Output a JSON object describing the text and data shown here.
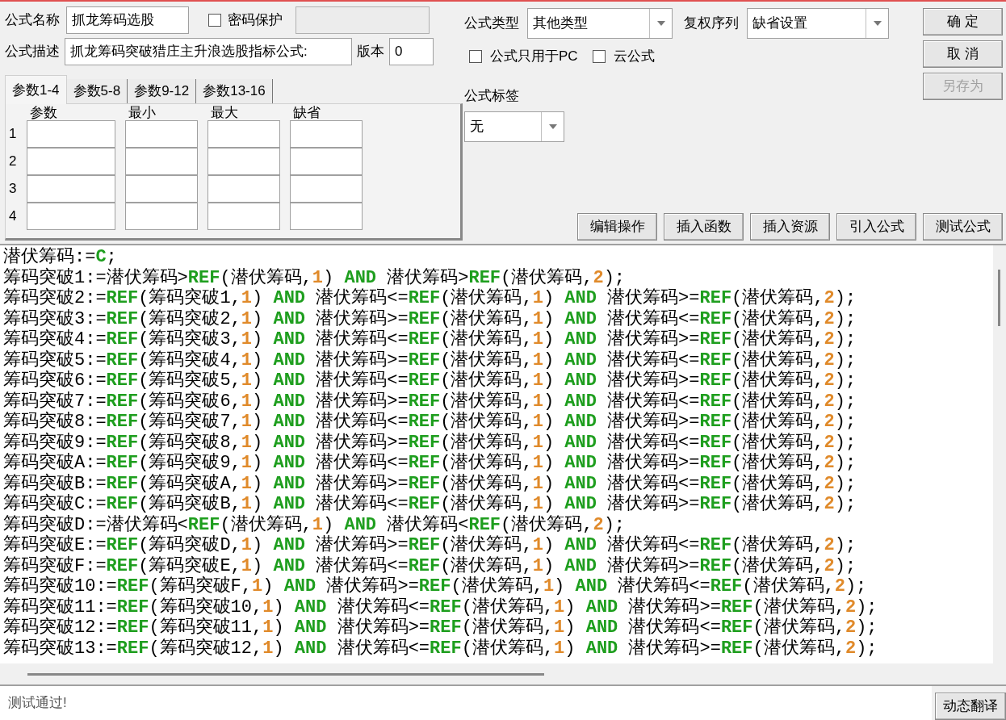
{
  "formula_name": {
    "label": "公式名称",
    "value": "抓龙筹码选股"
  },
  "password": {
    "label": "密码保护",
    "checked": false,
    "field_disabled": true
  },
  "description": {
    "label": "公式描述",
    "value": "抓龙筹码突破猎庄主升浪选股指标公式:"
  },
  "version": {
    "label": "版本",
    "value": "0"
  },
  "tabs": [
    {
      "label": "参数1-4",
      "selected": true
    },
    {
      "label": "参数5-8",
      "selected": false
    },
    {
      "label": "参数9-12",
      "selected": false
    },
    {
      "label": "参数13-16",
      "selected": false
    }
  ],
  "params": {
    "columns": [
      "参数",
      "最小",
      "最大",
      "缺省"
    ],
    "rows": [
      {
        "index": "1"
      },
      {
        "index": "2"
      },
      {
        "index": "3"
      },
      {
        "index": "4"
      }
    ]
  },
  "formula_type": {
    "label": "公式类型",
    "value": "其他类型"
  },
  "adjust_sequence": {
    "label": "复权序列",
    "value": "缺省设置"
  },
  "options": [
    {
      "label": "公式只用于PC",
      "checked": false
    },
    {
      "label": "云公式",
      "checked": false
    }
  ],
  "formula_tag": {
    "label": "公式标签",
    "value": "无"
  },
  "side_buttons": [
    {
      "label": "确 定",
      "disabled": false
    },
    {
      "label": "取 消",
      "disabled": false
    },
    {
      "label": "另存为",
      "disabled": true
    }
  ],
  "tool_buttons": [
    "编辑操作",
    "插入函数",
    "插入资源",
    "引入公式",
    "测试公式"
  ],
  "code_lines": [
    [
      {
        "kind": "plain",
        "text": "潜伏筹码:="
      },
      {
        "kind": "func",
        "text": "C"
      },
      {
        "kind": "plain",
        "text": ";"
      }
    ],
    [
      {
        "kind": "plain",
        "text": "筹码突破1:=潜伏筹码>"
      },
      {
        "kind": "func",
        "text": "REF"
      },
      {
        "kind": "plain",
        "text": "(潜伏筹码,"
      },
      {
        "kind": "num",
        "text": "1"
      },
      {
        "kind": "plain",
        "text": ") "
      },
      {
        "kind": "keyword",
        "text": "AND"
      },
      {
        "kind": "plain",
        "text": " 潜伏筹码>"
      },
      {
        "kind": "func",
        "text": "REF"
      },
      {
        "kind": "plain",
        "text": "(潜伏筹码,"
      },
      {
        "kind": "num",
        "text": "2"
      },
      {
        "kind": "plain",
        "text": ");"
      }
    ],
    [
      {
        "kind": "plain",
        "text": "筹码突破2:="
      },
      {
        "kind": "func",
        "text": "REF"
      },
      {
        "kind": "plain",
        "text": "(筹码突破1,"
      },
      {
        "kind": "num",
        "text": "1"
      },
      {
        "kind": "plain",
        "text": ") "
      },
      {
        "kind": "keyword",
        "text": "AND"
      },
      {
        "kind": "plain",
        "text": " 潜伏筹码<="
      },
      {
        "kind": "func",
        "text": "REF"
      },
      {
        "kind": "plain",
        "text": "(潜伏筹码,"
      },
      {
        "kind": "num",
        "text": "1"
      },
      {
        "kind": "plain",
        "text": ") "
      },
      {
        "kind": "keyword",
        "text": "AND"
      },
      {
        "kind": "plain",
        "text": " 潜伏筹码>="
      },
      {
        "kind": "func",
        "text": "REF"
      },
      {
        "kind": "plain",
        "text": "(潜伏筹码,"
      },
      {
        "kind": "num",
        "text": "2"
      },
      {
        "kind": "plain",
        "text": ");"
      }
    ],
    [
      {
        "kind": "plain",
        "text": "筹码突破3:="
      },
      {
        "kind": "func",
        "text": "REF"
      },
      {
        "kind": "plain",
        "text": "(筹码突破2,"
      },
      {
        "kind": "num",
        "text": "1"
      },
      {
        "kind": "plain",
        "text": ") "
      },
      {
        "kind": "keyword",
        "text": "AND"
      },
      {
        "kind": "plain",
        "text": " 潜伏筹码>="
      },
      {
        "kind": "func",
        "text": "REF"
      },
      {
        "kind": "plain",
        "text": "(潜伏筹码,"
      },
      {
        "kind": "num",
        "text": "1"
      },
      {
        "kind": "plain",
        "text": ") "
      },
      {
        "kind": "keyword",
        "text": "AND"
      },
      {
        "kind": "plain",
        "text": " 潜伏筹码<="
      },
      {
        "kind": "func",
        "text": "REF"
      },
      {
        "kind": "plain",
        "text": "(潜伏筹码,"
      },
      {
        "kind": "num",
        "text": "2"
      },
      {
        "kind": "plain",
        "text": ");"
      }
    ],
    [
      {
        "kind": "plain",
        "text": "筹码突破4:="
      },
      {
        "kind": "func",
        "text": "REF"
      },
      {
        "kind": "plain",
        "text": "(筹码突破3,"
      },
      {
        "kind": "num",
        "text": "1"
      },
      {
        "kind": "plain",
        "text": ") "
      },
      {
        "kind": "keyword",
        "text": "AND"
      },
      {
        "kind": "plain",
        "text": " 潜伏筹码<="
      },
      {
        "kind": "func",
        "text": "REF"
      },
      {
        "kind": "plain",
        "text": "(潜伏筹码,"
      },
      {
        "kind": "num",
        "text": "1"
      },
      {
        "kind": "plain",
        "text": ") "
      },
      {
        "kind": "keyword",
        "text": "AND"
      },
      {
        "kind": "plain",
        "text": " 潜伏筹码>="
      },
      {
        "kind": "func",
        "text": "REF"
      },
      {
        "kind": "plain",
        "text": "(潜伏筹码,"
      },
      {
        "kind": "num",
        "text": "2"
      },
      {
        "kind": "plain",
        "text": ");"
      }
    ],
    [
      {
        "kind": "plain",
        "text": "筹码突破5:="
      },
      {
        "kind": "func",
        "text": "REF"
      },
      {
        "kind": "plain",
        "text": "(筹码突破4,"
      },
      {
        "kind": "num",
        "text": "1"
      },
      {
        "kind": "plain",
        "text": ") "
      },
      {
        "kind": "keyword",
        "text": "AND"
      },
      {
        "kind": "plain",
        "text": " 潜伏筹码>="
      },
      {
        "kind": "func",
        "text": "REF"
      },
      {
        "kind": "plain",
        "text": "(潜伏筹码,"
      },
      {
        "kind": "num",
        "text": "1"
      },
      {
        "kind": "plain",
        "text": ") "
      },
      {
        "kind": "keyword",
        "text": "AND"
      },
      {
        "kind": "plain",
        "text": " 潜伏筹码<="
      },
      {
        "kind": "func",
        "text": "REF"
      },
      {
        "kind": "plain",
        "text": "(潜伏筹码,"
      },
      {
        "kind": "num",
        "text": "2"
      },
      {
        "kind": "plain",
        "text": ");"
      }
    ],
    [
      {
        "kind": "plain",
        "text": "筹码突破6:="
      },
      {
        "kind": "func",
        "text": "REF"
      },
      {
        "kind": "plain",
        "text": "(筹码突破5,"
      },
      {
        "kind": "num",
        "text": "1"
      },
      {
        "kind": "plain",
        "text": ") "
      },
      {
        "kind": "keyword",
        "text": "AND"
      },
      {
        "kind": "plain",
        "text": " 潜伏筹码<="
      },
      {
        "kind": "func",
        "text": "REF"
      },
      {
        "kind": "plain",
        "text": "(潜伏筹码,"
      },
      {
        "kind": "num",
        "text": "1"
      },
      {
        "kind": "plain",
        "text": ") "
      },
      {
        "kind": "keyword",
        "text": "AND"
      },
      {
        "kind": "plain",
        "text": " 潜伏筹码>="
      },
      {
        "kind": "func",
        "text": "REF"
      },
      {
        "kind": "plain",
        "text": "(潜伏筹码,"
      },
      {
        "kind": "num",
        "text": "2"
      },
      {
        "kind": "plain",
        "text": ");"
      }
    ],
    [
      {
        "kind": "plain",
        "text": "筹码突破7:="
      },
      {
        "kind": "func",
        "text": "REF"
      },
      {
        "kind": "plain",
        "text": "(筹码突破6,"
      },
      {
        "kind": "num",
        "text": "1"
      },
      {
        "kind": "plain",
        "text": ") "
      },
      {
        "kind": "keyword",
        "text": "AND"
      },
      {
        "kind": "plain",
        "text": " 潜伏筹码>="
      },
      {
        "kind": "func",
        "text": "REF"
      },
      {
        "kind": "plain",
        "text": "(潜伏筹码,"
      },
      {
        "kind": "num",
        "text": "1"
      },
      {
        "kind": "plain",
        "text": ") "
      },
      {
        "kind": "keyword",
        "text": "AND"
      },
      {
        "kind": "plain",
        "text": " 潜伏筹码<="
      },
      {
        "kind": "func",
        "text": "REF"
      },
      {
        "kind": "plain",
        "text": "(潜伏筹码,"
      },
      {
        "kind": "num",
        "text": "2"
      },
      {
        "kind": "plain",
        "text": ");"
      }
    ],
    [
      {
        "kind": "plain",
        "text": "筹码突破8:="
      },
      {
        "kind": "func",
        "text": "REF"
      },
      {
        "kind": "plain",
        "text": "(筹码突破7,"
      },
      {
        "kind": "num",
        "text": "1"
      },
      {
        "kind": "plain",
        "text": ") "
      },
      {
        "kind": "keyword",
        "text": "AND"
      },
      {
        "kind": "plain",
        "text": " 潜伏筹码<="
      },
      {
        "kind": "func",
        "text": "REF"
      },
      {
        "kind": "plain",
        "text": "(潜伏筹码,"
      },
      {
        "kind": "num",
        "text": "1"
      },
      {
        "kind": "plain",
        "text": ") "
      },
      {
        "kind": "keyword",
        "text": "AND"
      },
      {
        "kind": "plain",
        "text": " 潜伏筹码>="
      },
      {
        "kind": "func",
        "text": "REF"
      },
      {
        "kind": "plain",
        "text": "(潜伏筹码,"
      },
      {
        "kind": "num",
        "text": "2"
      },
      {
        "kind": "plain",
        "text": ");"
      }
    ],
    [
      {
        "kind": "plain",
        "text": "筹码突破9:="
      },
      {
        "kind": "func",
        "text": "REF"
      },
      {
        "kind": "plain",
        "text": "(筹码突破8,"
      },
      {
        "kind": "num",
        "text": "1"
      },
      {
        "kind": "plain",
        "text": ") "
      },
      {
        "kind": "keyword",
        "text": "AND"
      },
      {
        "kind": "plain",
        "text": " 潜伏筹码>="
      },
      {
        "kind": "func",
        "text": "REF"
      },
      {
        "kind": "plain",
        "text": "(潜伏筹码,"
      },
      {
        "kind": "num",
        "text": "1"
      },
      {
        "kind": "plain",
        "text": ") "
      },
      {
        "kind": "keyword",
        "text": "AND"
      },
      {
        "kind": "plain",
        "text": " 潜伏筹码<="
      },
      {
        "kind": "func",
        "text": "REF"
      },
      {
        "kind": "plain",
        "text": "(潜伏筹码,"
      },
      {
        "kind": "num",
        "text": "2"
      },
      {
        "kind": "plain",
        "text": ");"
      }
    ],
    [
      {
        "kind": "plain",
        "text": "筹码突破A:="
      },
      {
        "kind": "func",
        "text": "REF"
      },
      {
        "kind": "plain",
        "text": "(筹码突破9,"
      },
      {
        "kind": "num",
        "text": "1"
      },
      {
        "kind": "plain",
        "text": ") "
      },
      {
        "kind": "keyword",
        "text": "AND"
      },
      {
        "kind": "plain",
        "text": " 潜伏筹码<="
      },
      {
        "kind": "func",
        "text": "REF"
      },
      {
        "kind": "plain",
        "text": "(潜伏筹码,"
      },
      {
        "kind": "num",
        "text": "1"
      },
      {
        "kind": "plain",
        "text": ") "
      },
      {
        "kind": "keyword",
        "text": "AND"
      },
      {
        "kind": "plain",
        "text": " 潜伏筹码>="
      },
      {
        "kind": "func",
        "text": "REF"
      },
      {
        "kind": "plain",
        "text": "(潜伏筹码,"
      },
      {
        "kind": "num",
        "text": "2"
      },
      {
        "kind": "plain",
        "text": ");"
      }
    ],
    [
      {
        "kind": "plain",
        "text": "筹码突破B:="
      },
      {
        "kind": "func",
        "text": "REF"
      },
      {
        "kind": "plain",
        "text": "(筹码突破A,"
      },
      {
        "kind": "num",
        "text": "1"
      },
      {
        "kind": "plain",
        "text": ") "
      },
      {
        "kind": "keyword",
        "text": "AND"
      },
      {
        "kind": "plain",
        "text": " 潜伏筹码>="
      },
      {
        "kind": "func",
        "text": "REF"
      },
      {
        "kind": "plain",
        "text": "(潜伏筹码,"
      },
      {
        "kind": "num",
        "text": "1"
      },
      {
        "kind": "plain",
        "text": ") "
      },
      {
        "kind": "keyword",
        "text": "AND"
      },
      {
        "kind": "plain",
        "text": " 潜伏筹码<="
      },
      {
        "kind": "func",
        "text": "REF"
      },
      {
        "kind": "plain",
        "text": "(潜伏筹码,"
      },
      {
        "kind": "num",
        "text": "2"
      },
      {
        "kind": "plain",
        "text": ");"
      }
    ],
    [
      {
        "kind": "plain",
        "text": "筹码突破C:="
      },
      {
        "kind": "func",
        "text": "REF"
      },
      {
        "kind": "plain",
        "text": "(筹码突破B,"
      },
      {
        "kind": "num",
        "text": "1"
      },
      {
        "kind": "plain",
        "text": ") "
      },
      {
        "kind": "keyword",
        "text": "AND"
      },
      {
        "kind": "plain",
        "text": " 潜伏筹码<="
      },
      {
        "kind": "func",
        "text": "REF"
      },
      {
        "kind": "plain",
        "text": "(潜伏筹码,"
      },
      {
        "kind": "num",
        "text": "1"
      },
      {
        "kind": "plain",
        "text": ") "
      },
      {
        "kind": "keyword",
        "text": "AND"
      },
      {
        "kind": "plain",
        "text": " 潜伏筹码>="
      },
      {
        "kind": "func",
        "text": "REF"
      },
      {
        "kind": "plain",
        "text": "(潜伏筹码,"
      },
      {
        "kind": "num",
        "text": "2"
      },
      {
        "kind": "plain",
        "text": ");"
      }
    ],
    [
      {
        "kind": "plain",
        "text": "筹码突破D:=潜伏筹码<"
      },
      {
        "kind": "func",
        "text": "REF"
      },
      {
        "kind": "plain",
        "text": "(潜伏筹码,"
      },
      {
        "kind": "num",
        "text": "1"
      },
      {
        "kind": "plain",
        "text": ") "
      },
      {
        "kind": "keyword",
        "text": "AND"
      },
      {
        "kind": "plain",
        "text": " 潜伏筹码<"
      },
      {
        "kind": "func",
        "text": "REF"
      },
      {
        "kind": "plain",
        "text": "(潜伏筹码,"
      },
      {
        "kind": "num",
        "text": "2"
      },
      {
        "kind": "plain",
        "text": ");"
      }
    ],
    [
      {
        "kind": "plain",
        "text": "筹码突破E:="
      },
      {
        "kind": "func",
        "text": "REF"
      },
      {
        "kind": "plain",
        "text": "(筹码突破D,"
      },
      {
        "kind": "num",
        "text": "1"
      },
      {
        "kind": "plain",
        "text": ") "
      },
      {
        "kind": "keyword",
        "text": "AND"
      },
      {
        "kind": "plain",
        "text": " 潜伏筹码>="
      },
      {
        "kind": "func",
        "text": "REF"
      },
      {
        "kind": "plain",
        "text": "(潜伏筹码,"
      },
      {
        "kind": "num",
        "text": "1"
      },
      {
        "kind": "plain",
        "text": ") "
      },
      {
        "kind": "keyword",
        "text": "AND"
      },
      {
        "kind": "plain",
        "text": " 潜伏筹码<="
      },
      {
        "kind": "func",
        "text": "REF"
      },
      {
        "kind": "plain",
        "text": "(潜伏筹码,"
      },
      {
        "kind": "num",
        "text": "2"
      },
      {
        "kind": "plain",
        "text": ");"
      }
    ],
    [
      {
        "kind": "plain",
        "text": "筹码突破F:="
      },
      {
        "kind": "func",
        "text": "REF"
      },
      {
        "kind": "plain",
        "text": "(筹码突破E,"
      },
      {
        "kind": "num",
        "text": "1"
      },
      {
        "kind": "plain",
        "text": ") "
      },
      {
        "kind": "keyword",
        "text": "AND"
      },
      {
        "kind": "plain",
        "text": " 潜伏筹码<="
      },
      {
        "kind": "func",
        "text": "REF"
      },
      {
        "kind": "plain",
        "text": "(潜伏筹码,"
      },
      {
        "kind": "num",
        "text": "1"
      },
      {
        "kind": "plain",
        "text": ") "
      },
      {
        "kind": "keyword",
        "text": "AND"
      },
      {
        "kind": "plain",
        "text": " 潜伏筹码>="
      },
      {
        "kind": "func",
        "text": "REF"
      },
      {
        "kind": "plain",
        "text": "(潜伏筹码,"
      },
      {
        "kind": "num",
        "text": "2"
      },
      {
        "kind": "plain",
        "text": ");"
      }
    ],
    [
      {
        "kind": "plain",
        "text": "筹码突破10:="
      },
      {
        "kind": "func",
        "text": "REF"
      },
      {
        "kind": "plain",
        "text": "(筹码突破F,"
      },
      {
        "kind": "num",
        "text": "1"
      },
      {
        "kind": "plain",
        "text": ") "
      },
      {
        "kind": "keyword",
        "text": "AND"
      },
      {
        "kind": "plain",
        "text": " 潜伏筹码>="
      },
      {
        "kind": "func",
        "text": "REF"
      },
      {
        "kind": "plain",
        "text": "(潜伏筹码,"
      },
      {
        "kind": "num",
        "text": "1"
      },
      {
        "kind": "plain",
        "text": ") "
      },
      {
        "kind": "keyword",
        "text": "AND"
      },
      {
        "kind": "plain",
        "text": " 潜伏筹码<="
      },
      {
        "kind": "func",
        "text": "REF"
      },
      {
        "kind": "plain",
        "text": "(潜伏筹码,"
      },
      {
        "kind": "num",
        "text": "2"
      },
      {
        "kind": "plain",
        "text": ");"
      }
    ],
    [
      {
        "kind": "plain",
        "text": "筹码突破11:="
      },
      {
        "kind": "func",
        "text": "REF"
      },
      {
        "kind": "plain",
        "text": "(筹码突破10,"
      },
      {
        "kind": "num",
        "text": "1"
      },
      {
        "kind": "plain",
        "text": ") "
      },
      {
        "kind": "keyword",
        "text": "AND"
      },
      {
        "kind": "plain",
        "text": " 潜伏筹码<="
      },
      {
        "kind": "func",
        "text": "REF"
      },
      {
        "kind": "plain",
        "text": "(潜伏筹码,"
      },
      {
        "kind": "num",
        "text": "1"
      },
      {
        "kind": "plain",
        "text": ") "
      },
      {
        "kind": "keyword",
        "text": "AND"
      },
      {
        "kind": "plain",
        "text": " 潜伏筹码>="
      },
      {
        "kind": "func",
        "text": "REF"
      },
      {
        "kind": "plain",
        "text": "(潜伏筹码,"
      },
      {
        "kind": "num",
        "text": "2"
      },
      {
        "kind": "plain",
        "text": ");"
      }
    ],
    [
      {
        "kind": "plain",
        "text": "筹码突破12:="
      },
      {
        "kind": "func",
        "text": "REF"
      },
      {
        "kind": "plain",
        "text": "(筹码突破11,"
      },
      {
        "kind": "num",
        "text": "1"
      },
      {
        "kind": "plain",
        "text": ") "
      },
      {
        "kind": "keyword",
        "text": "AND"
      },
      {
        "kind": "plain",
        "text": " 潜伏筹码>="
      },
      {
        "kind": "func",
        "text": "REF"
      },
      {
        "kind": "plain",
        "text": "(潜伏筹码,"
      },
      {
        "kind": "num",
        "text": "1"
      },
      {
        "kind": "plain",
        "text": ") "
      },
      {
        "kind": "keyword",
        "text": "AND"
      },
      {
        "kind": "plain",
        "text": " 潜伏筹码<="
      },
      {
        "kind": "func",
        "text": "REF"
      },
      {
        "kind": "plain",
        "text": "(潜伏筹码,"
      },
      {
        "kind": "num",
        "text": "2"
      },
      {
        "kind": "plain",
        "text": ");"
      }
    ],
    [
      {
        "kind": "plain",
        "text": "筹码突破13:="
      },
      {
        "kind": "func",
        "text": "REF"
      },
      {
        "kind": "plain",
        "text": "(筹码突破12,"
      },
      {
        "kind": "num",
        "text": "1"
      },
      {
        "kind": "plain",
        "text": ") "
      },
      {
        "kind": "keyword",
        "text": "AND"
      },
      {
        "kind": "plain",
        "text": " 潜伏筹码<="
      },
      {
        "kind": "func",
        "text": "REF"
      },
      {
        "kind": "plain",
        "text": "(潜伏筹码,"
      },
      {
        "kind": "num",
        "text": "1"
      },
      {
        "kind": "plain",
        "text": ") "
      },
      {
        "kind": "keyword",
        "text": "AND"
      },
      {
        "kind": "plain",
        "text": " 潜伏筹码>="
      },
      {
        "kind": "func",
        "text": "REF"
      },
      {
        "kind": "plain",
        "text": "(潜伏筹码,"
      },
      {
        "kind": "num",
        "text": "2"
      },
      {
        "kind": "plain",
        "text": ");"
      }
    ]
  ],
  "status": "测试通过!",
  "translate_button": "动态翻译"
}
